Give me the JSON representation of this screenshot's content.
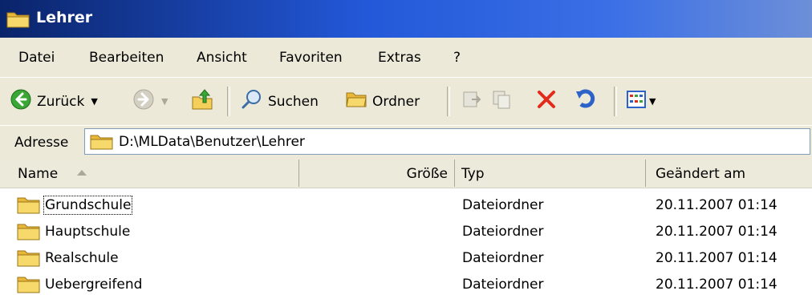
{
  "window": {
    "title": "Lehrer"
  },
  "menu": {
    "items": [
      {
        "label": "Datei"
      },
      {
        "label": "Bearbeiten"
      },
      {
        "label": "Ansicht"
      },
      {
        "label": "Favoriten"
      },
      {
        "label": "Extras"
      },
      {
        "label": "?"
      }
    ]
  },
  "toolbar": {
    "back_label": "Zurück",
    "search_label": "Suchen",
    "folders_label": "Ordner"
  },
  "address": {
    "label": "Adresse",
    "value": "D:\\MLData\\Benutzer\\Lehrer"
  },
  "list": {
    "columns": [
      {
        "label": "Name"
      },
      {
        "label": "Größe"
      },
      {
        "label": "Typ"
      },
      {
        "label": "Geändert am"
      }
    ],
    "rows": [
      {
        "name": "Grundschule",
        "size": "",
        "type": "Dateiordner",
        "modified": "20.11.2007 01:14"
      },
      {
        "name": "Hauptschule",
        "size": "",
        "type": "Dateiordner",
        "modified": "20.11.2007 01:14"
      },
      {
        "name": "Realschule",
        "size": "",
        "type": "Dateiordner",
        "modified": "20.11.2007 01:14"
      },
      {
        "name": "Uebergreifend",
        "size": "",
        "type": "Dateiordner",
        "modified": "20.11.2007 01:14"
      }
    ]
  },
  "colors": {
    "title_bar_start": "#0a246a",
    "title_bar_end": "#6d8fd8",
    "chrome": "#ece9d8",
    "folder_yellow": "#f4cf5a",
    "delete_red": "#e22b1c",
    "back_green": "#3aa636"
  },
  "icons": [
    "folder-icon",
    "back-icon",
    "forward-icon",
    "up-folder-icon",
    "search-icon",
    "folders-icon",
    "move-to-icon",
    "copy-to-icon",
    "delete-icon",
    "undo-icon",
    "views-icon"
  ]
}
